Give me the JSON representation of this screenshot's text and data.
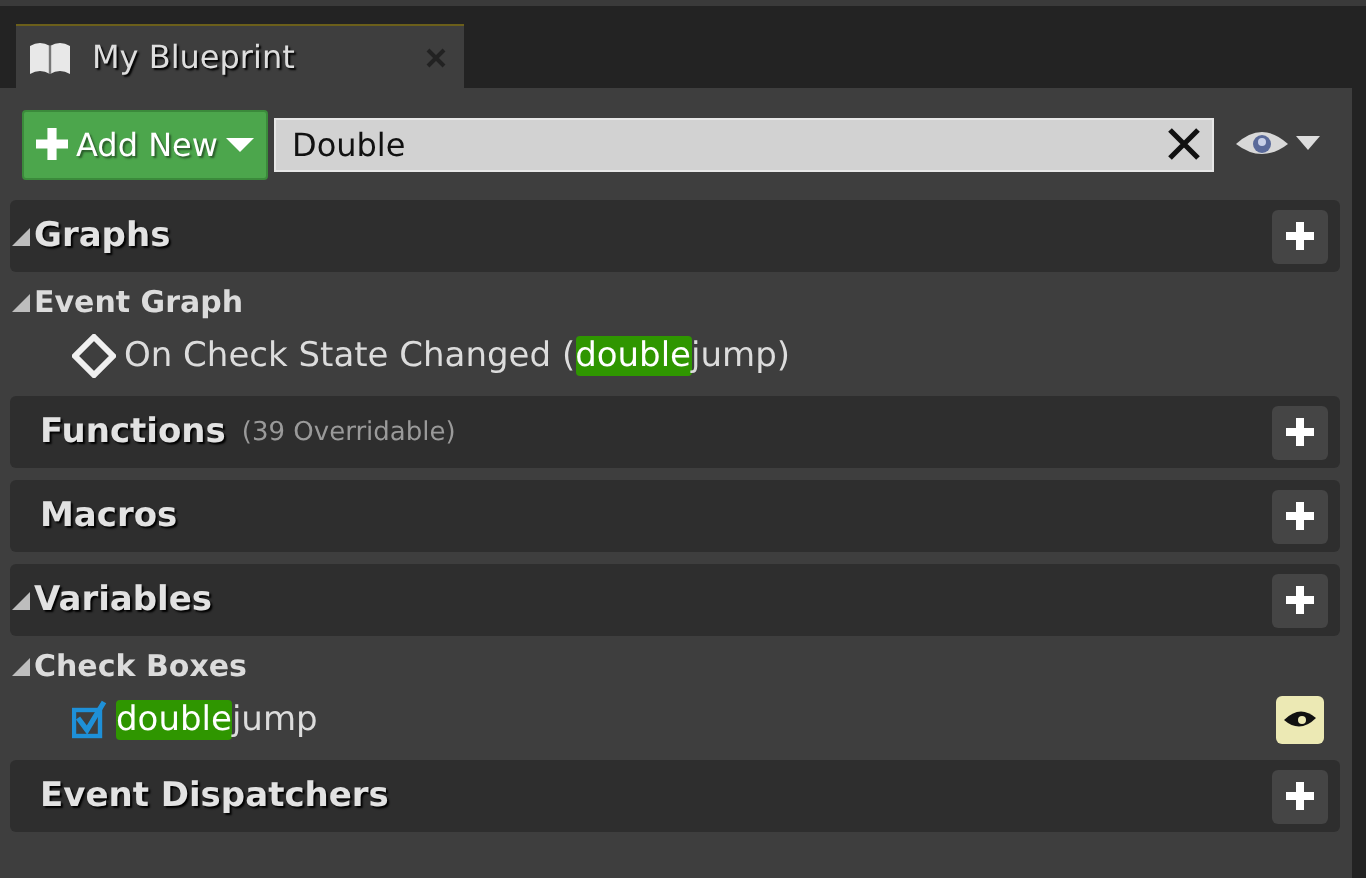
{
  "tab": {
    "title": "My Blueprint"
  },
  "toolbar": {
    "add_button": "Add New",
    "search": {
      "value": "Double"
    }
  },
  "sections": [
    {
      "title": "Graphs",
      "expanded": true,
      "categories": [
        {
          "title": "Event Graph",
          "expanded": true,
          "items": [
            {
              "kind": "event",
              "prefix": "On Check State Changed (",
              "highlight": "double",
              "suffix": "jump)"
            }
          ]
        }
      ]
    },
    {
      "title": "Functions",
      "note": "(39 Overridable)"
    },
    {
      "title": "Macros"
    },
    {
      "title": "Variables",
      "expanded": true,
      "categories": [
        {
          "title": "Check Boxes",
          "expanded": true,
          "items": [
            {
              "kind": "variable",
              "highlight": "double",
              "suffix": "jump",
              "public": true
            }
          ]
        }
      ]
    },
    {
      "title": "Event Dispatchers"
    }
  ]
}
